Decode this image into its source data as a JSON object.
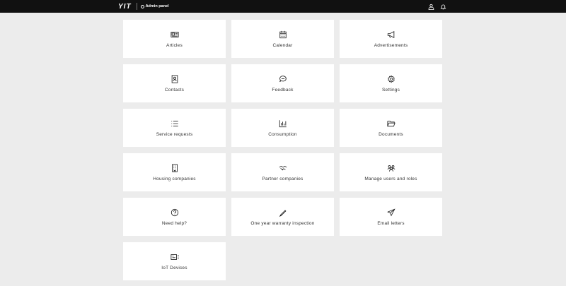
{
  "header": {
    "logo": "YIT",
    "admin_panel": "Admin panel",
    "icons": [
      "user-icon",
      "bell-icon"
    ]
  },
  "tiles": [
    {
      "label": "Articles",
      "icon": "newspaper-icon"
    },
    {
      "label": "Calendar",
      "icon": "calendar-icon"
    },
    {
      "label": "Advertisements",
      "icon": "megaphone-icon"
    },
    {
      "label": "Contacts",
      "icon": "contact-card-icon"
    },
    {
      "label": "Feedback",
      "icon": "chat-bubble-icon"
    },
    {
      "label": "Settings",
      "icon": "gear-icon"
    },
    {
      "label": "Service requests",
      "icon": "list-icon"
    },
    {
      "label": "Consumption",
      "icon": "bar-chart-icon"
    },
    {
      "label": "Documents",
      "icon": "folder-icon"
    },
    {
      "label": "Housing companies",
      "icon": "building-icon"
    },
    {
      "label": "Partner companies",
      "icon": "handshake-icon"
    },
    {
      "label": "Manage users and roles",
      "icon": "users-icon"
    },
    {
      "label": "Need help?",
      "icon": "question-icon"
    },
    {
      "label": "One year warranty inspection",
      "icon": "pen-icon"
    },
    {
      "label": "Email letters",
      "icon": "paper-plane-icon"
    },
    {
      "label": "IoT Devices",
      "icon": "device-icon"
    }
  ]
}
